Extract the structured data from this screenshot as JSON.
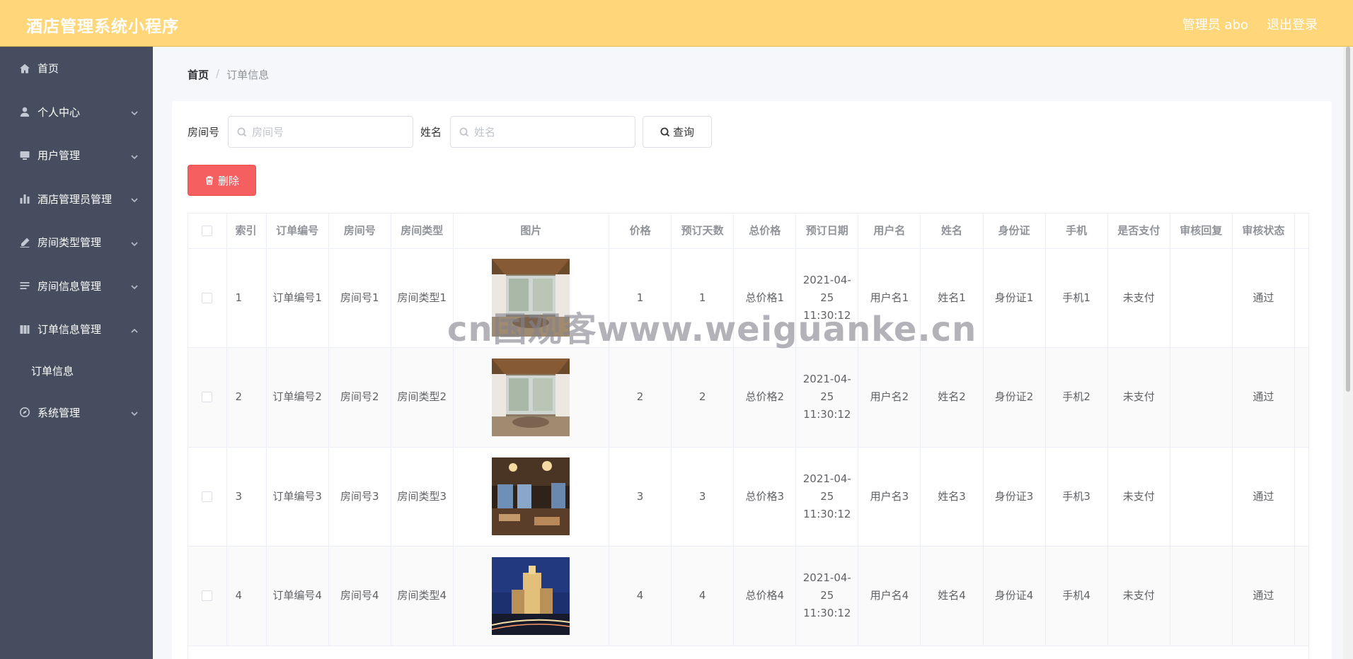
{
  "header": {
    "title": "酒店管理系统小程序",
    "user_label": "管理员 abo",
    "logout_label": "退出登录"
  },
  "sidebar": {
    "items": [
      {
        "label": "首页",
        "icon": "home-icon",
        "has_chevron": false
      },
      {
        "label": "个人中心",
        "icon": "user-icon",
        "has_chevron": true
      },
      {
        "label": "用户管理",
        "icon": "monitor-icon",
        "has_chevron": true
      },
      {
        "label": "酒店管理员管理",
        "icon": "bar-chart-icon",
        "has_chevron": true
      },
      {
        "label": "房间类型管理",
        "icon": "edit-icon",
        "has_chevron": true
      },
      {
        "label": "房间信息管理",
        "icon": "list-icon",
        "has_chevron": true
      },
      {
        "label": "订单信息管理",
        "icon": "book-icon",
        "has_chevron": true,
        "expanded": true
      }
    ],
    "sub_item": "订单信息",
    "last_item": {
      "label": "系统管理",
      "icon": "compass-icon",
      "has_chevron": true
    }
  },
  "breadcrumb": {
    "home": "首页",
    "separator": "/",
    "current": "订单信息"
  },
  "search": {
    "room_label": "房间号",
    "room_placeholder": "房间号",
    "name_label": "姓名",
    "name_placeholder": "姓名",
    "query_label": "查询"
  },
  "actions": {
    "delete_label": "删除"
  },
  "table": {
    "headers": [
      "索引",
      "订单编号",
      "房间号",
      "房间类型",
      "图片",
      "价格",
      "预订天数",
      "总价格",
      "预订日期",
      "用户名",
      "姓名",
      "身份证",
      "手机",
      "是否支付",
      "审核回复",
      "审核状态"
    ],
    "rows": [
      {
        "index": "1",
        "order_no": "订单编号1",
        "room_no": "房间号1",
        "room_type": "房间类型1",
        "image": "hotel-room-photo",
        "price": "1",
        "days": "1",
        "total": "总价格1",
        "date": "2021-04-25 11:30:12",
        "username": "用户名1",
        "name": "姓名1",
        "id_card": "身份证1",
        "phone": "手机1",
        "paid": "未支付",
        "reply": "",
        "status": "通过"
      },
      {
        "index": "2",
        "order_no": "订单编号2",
        "room_no": "房间号2",
        "room_type": "房间类型2",
        "image": "hotel-room-photo",
        "price": "2",
        "days": "2",
        "total": "总价格2",
        "date": "2021-04-25 11:30:12",
        "username": "用户名2",
        "name": "姓名2",
        "id_card": "身份证2",
        "phone": "手机2",
        "paid": "未支付",
        "reply": "",
        "status": "通过"
      },
      {
        "index": "3",
        "order_no": "订单编号3",
        "room_no": "房间号3",
        "room_type": "房间类型3",
        "image": "hotel-lobby-photo",
        "price": "3",
        "days": "3",
        "total": "总价格3",
        "date": "2021-04-25 11:30:12",
        "username": "用户名3",
        "name": "姓名3",
        "id_card": "身份证3",
        "phone": "手机3",
        "paid": "未支付",
        "reply": "",
        "status": "通过"
      },
      {
        "index": "4",
        "order_no": "订单编号4",
        "room_no": "房间号4",
        "room_type": "房间类型4",
        "image": "hotel-night-photo",
        "price": "4",
        "days": "4",
        "total": "总价格4",
        "date": "2021-04-25 11:30:12",
        "username": "用户名4",
        "name": "姓名4",
        "id_card": "身份证4",
        "phone": "手机4",
        "paid": "未支付",
        "reply": "",
        "status": "通过"
      }
    ]
  },
  "watermark": "cn国观客www.weiguanke.cn",
  "colors": {
    "header_bg": "#ffd77a",
    "sidebar_bg": "#454d5e",
    "delete_bg": "#f55f5f"
  }
}
